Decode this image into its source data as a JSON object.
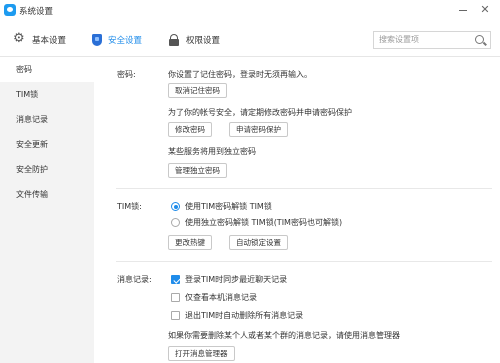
{
  "window": {
    "title": "系统设置",
    "minimize_glyph": "—",
    "close_glyph": "✕"
  },
  "tabs": [
    {
      "label": "基本设置",
      "icon": "gear-icon",
      "active": false
    },
    {
      "label": "安全设置",
      "icon": "shield-icon",
      "active": true
    },
    {
      "label": "权限设置",
      "icon": "lock-icon",
      "active": false
    }
  ],
  "search": {
    "placeholder": "搜索设置项"
  },
  "sidebar": {
    "items": [
      {
        "label": "密码",
        "active": true
      },
      {
        "label": "TIM锁",
        "active": false
      },
      {
        "label": "消息记录",
        "active": false
      },
      {
        "label": "安全更新",
        "active": false
      },
      {
        "label": "安全防护",
        "active": false
      },
      {
        "label": "文件传输",
        "active": false
      }
    ]
  },
  "password": {
    "label": "密码:",
    "remembered_text": "你设置了记住密码，登录时无须再输入。",
    "cancel_remember_button": "取消记住密码",
    "security_hint": "为了你的帐号安全，请定期修改密码并申请密码保护",
    "change_password_button": "修改密码",
    "apply_protection_button": "申请密码保护",
    "independent_hint": "某些服务将用到独立密码",
    "manage_independent_button": "管理独立密码"
  },
  "tim_lock": {
    "label": "TIM锁:",
    "options": [
      {
        "label": "使用TIM密码解锁 TIM锁",
        "selected": true
      },
      {
        "label": "使用独立密码解锁 TIM锁(TIM密码也可解锁)",
        "selected": false
      }
    ],
    "change_hotkey_button": "更改热键",
    "auto_lock_button": "自动锁定设置"
  },
  "message_records": {
    "label": "消息记录:",
    "options": [
      {
        "label": "登录TIM时同步最近聊天记录",
        "checked": true
      },
      {
        "label": "仅查看本机消息记录",
        "checked": false
      },
      {
        "label": "退出TIM时自动删除所有消息记录",
        "checked": false
      }
    ],
    "hint": "如果你需要删除某个人或者某个群的消息记录，请使用消息管理器",
    "open_manager_button": "打开消息管理器"
  },
  "colors": {
    "accent": "#1f8cea",
    "sidebar_bg": "#f3f3f3"
  }
}
